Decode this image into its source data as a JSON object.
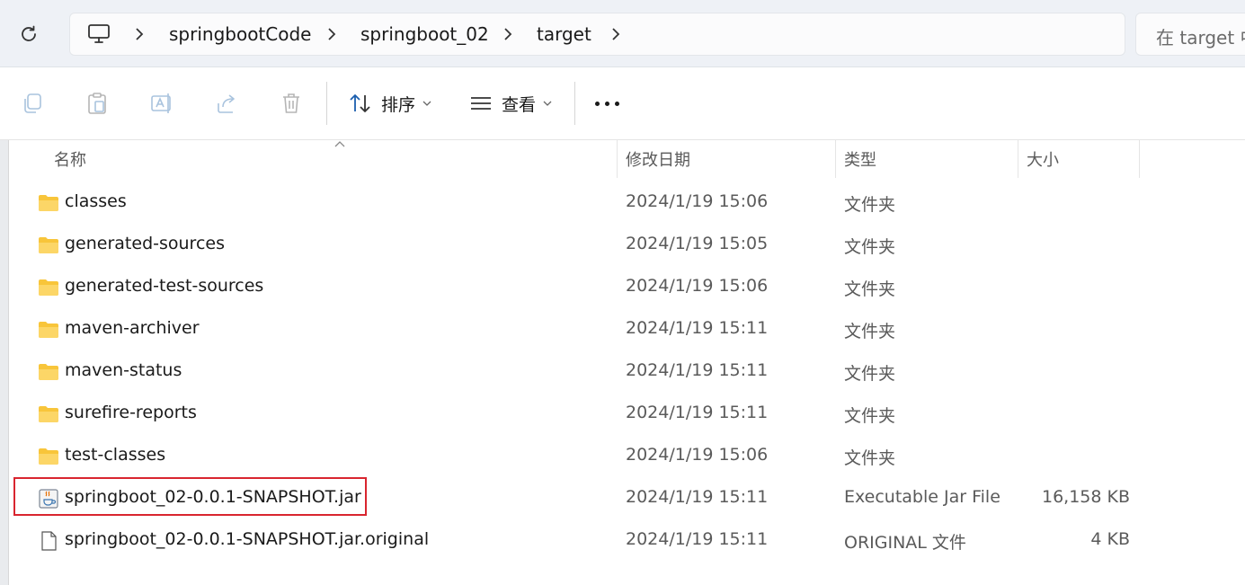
{
  "address": {
    "crumbs": [
      "springbootCode",
      "springboot_02",
      "target"
    ],
    "search_placeholder": "在 target 中"
  },
  "toolbar": {
    "sort_label": "排序",
    "view_label": "查看",
    "icons": [
      "copy-icon",
      "paste-icon",
      "rename-icon",
      "share-icon",
      "delete-icon",
      "sort-icon",
      "view-icon",
      "more-icon"
    ]
  },
  "columns": {
    "name": "名称",
    "date": "修改日期",
    "type": "类型",
    "size": "大小"
  },
  "files": [
    {
      "name": "classes",
      "date": "2024/1/19 15:06",
      "type": "文件夹",
      "size": "",
      "icon": "folder-icon"
    },
    {
      "name": "generated-sources",
      "date": "2024/1/19 15:05",
      "type": "文件夹",
      "size": "",
      "icon": "folder-icon"
    },
    {
      "name": "generated-test-sources",
      "date": "2024/1/19 15:06",
      "type": "文件夹",
      "size": "",
      "icon": "folder-icon"
    },
    {
      "name": "maven-archiver",
      "date": "2024/1/19 15:11",
      "type": "文件夹",
      "size": "",
      "icon": "folder-icon"
    },
    {
      "name": "maven-status",
      "date": "2024/1/19 15:11",
      "type": "文件夹",
      "size": "",
      "icon": "folder-icon"
    },
    {
      "name": "surefire-reports",
      "date": "2024/1/19 15:11",
      "type": "文件夹",
      "size": "",
      "icon": "folder-icon"
    },
    {
      "name": "test-classes",
      "date": "2024/1/19 15:06",
      "type": "文件夹",
      "size": "",
      "icon": "folder-icon"
    },
    {
      "name": "springboot_02-0.0.1-SNAPSHOT.jar",
      "date": "2024/1/19 15:11",
      "type": "Executable Jar File",
      "size": "16,158 KB",
      "icon": "java-jar-icon"
    },
    {
      "name": "springboot_02-0.0.1-SNAPSHOT.jar.original",
      "date": "2024/1/19 15:11",
      "type": "ORIGINAL 文件",
      "size": "4 KB",
      "icon": "file-icon"
    }
  ],
  "colors": {
    "folder": "#f8c53a",
    "highlight_border": "#d9252f",
    "address_bg": "#eef1f6"
  }
}
